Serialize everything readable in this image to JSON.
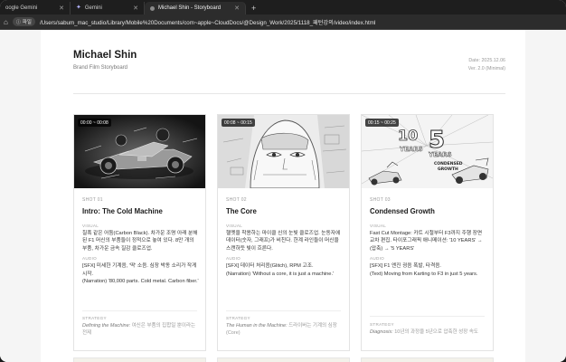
{
  "browser": {
    "tabs": [
      {
        "label": "oogle Gemini",
        "active": false
      },
      {
        "label": "Gemini",
        "active": false
      },
      {
        "label": "Michael Shin - Storyboard",
        "active": true
      }
    ],
    "new_tab": "+",
    "file_badge": "파일",
    "url": "/Users/sabum_mac_studio/Library/Mobile%20Documents/com~apple~CloudDocs/@Design_Work/2025/1118_패턴강의/video/index.html"
  },
  "header": {
    "title": "Michael Shin",
    "subtitle": "Brand Film Storyboard",
    "date": "Date: 2025.12.06",
    "version": "Ver. 2.0 (Minimal)"
  },
  "cards": [
    {
      "timecode": "00:00 ~ 00:08",
      "shot": "SHOT 01",
      "title": "Intro: The Cold Machine",
      "visual_label": "VISUAL",
      "visual": "칠흑 같은 어둠(Carbon Black). 차가운 조명 아래 분해된 F1 머신의 부품들이 정적으로 놓여 있다. 8만 개의 부품, 차가운 금속 질감 클로즈업.",
      "audio_label": "AUDIO",
      "audio_lines": [
        "[SFX] 미세한 기계음, '딱' 소음. 심장 박동 소리가 작게 시작.",
        "(Narration) '80,000 parts. Cold metal. Carbon fiber.'"
      ],
      "strategy_label": "STRATEGY",
      "strategy_en": "Defining the Machine:",
      "strategy_ko": " 여신은 부품의 집합일 뿐이라는 전제"
    },
    {
      "timecode": "00:08 ~ 00:15",
      "shot": "SHOT 02",
      "title": "The Core",
      "visual_label": "VISUAL",
      "visual": "헬멧을 착용하는 마이클 신의 눈빛 클로즈업. 눈동자에 데이터(숫자, 그래프)가 비친다. 한계 라인들이 머신을 스캔하듯 빛이 흐른다.",
      "audio_label": "AUDIO",
      "audio_lines": [
        "[SFX] 데이터 처리음(Glitch), RPM 고조.",
        "(Narration) 'Without a core, it is just a machine.'"
      ],
      "strategy_label": "STRATEGY",
      "strategy_en": "The Human in the Machine:",
      "strategy_ko": " 드라이버는 기계의 심장(Core)"
    },
    {
      "timecode": "00:15 ~ 00:25",
      "shot": "SHOT 03",
      "title": "Condensed Growth",
      "visual_label": "VISUAL",
      "visual": "Fast Cut Montage: 카트 시절부터 F3까지 주행 장면 교차 편집. 타이포그래픽 애니메이션: '10 YEARS' → (압축) → '5 YEARS'",
      "audio_label": "AUDIO",
      "audio_lines": [
        "[SFX] F1 엔진 굉음 폭발, 타격음.",
        "(Text) Moving from Karting to F3 in just 5 years."
      ],
      "strategy_label": "STRATEGY",
      "strategy_en": "Diagnosis:",
      "strategy_ko": " 10년의 과정을 5년으로 압축한 성장 속도"
    }
  ],
  "sketch_text": {
    "big_ten": "10",
    "big_five": "5",
    "years": "YEARS",
    "condensed": "CONDENSED",
    "growth": "GROWTH"
  }
}
